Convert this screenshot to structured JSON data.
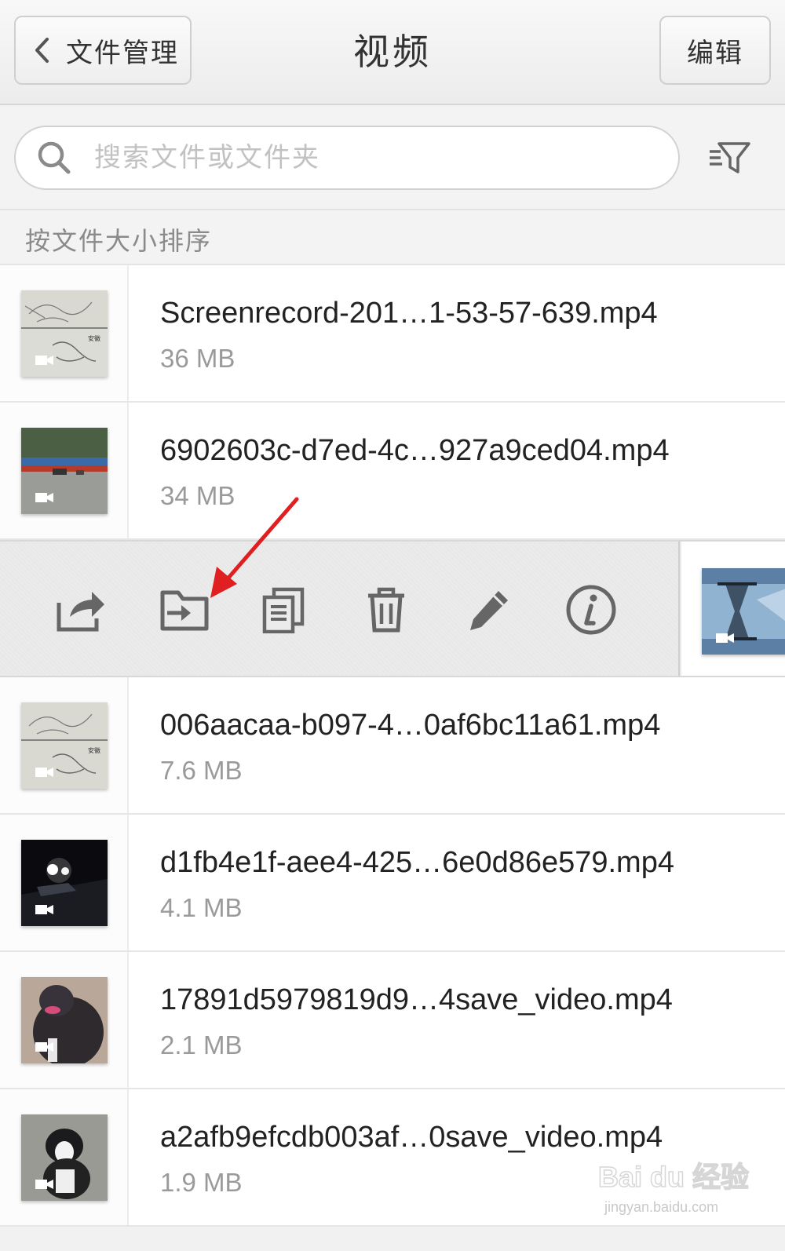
{
  "header": {
    "back_label": "文件管理",
    "title": "视频",
    "edit_label": "编辑"
  },
  "search": {
    "placeholder": "搜索文件或文件夹",
    "value": ""
  },
  "sort_label": "按文件大小排序",
  "files": [
    {
      "name": "Screenrecord-201…1-53-57-639.mp4",
      "size": "36 MB",
      "thumb": "sketch"
    },
    {
      "name": "6902603c-d7ed-4c…927a9ced04.mp4",
      "size": "34 MB",
      "thumb": "street"
    },
    {
      "name": "006aacaa-b097-4…0af6bc11a61.mp4",
      "size": "7.6 MB",
      "thumb": "sketch"
    },
    {
      "name": "d1fb4e1f-aee4-425…6e0d86e579.mp4",
      "size": "4.1 MB",
      "thumb": "night-road"
    },
    {
      "name": "17891d5979819d9…4save_video.mp4",
      "size": "2.1 MB",
      "thumb": "dog-dark"
    },
    {
      "name": "a2afb9efcdb003af…0save_video.mp4",
      "size": "1.9 MB",
      "thumb": "dog-husky"
    }
  ],
  "action_bar": {
    "actions": [
      "share-icon",
      "move-icon",
      "copy-icon",
      "delete-icon",
      "rename-icon",
      "info-icon"
    ],
    "highlighted_action": "move-icon",
    "annotation_arrow_color": "#e02020",
    "swiped_row_thumb": "hourglass"
  },
  "watermark": {
    "logo_text": "Bai du 经验",
    "sub_text": "jingyan.baidu.com"
  }
}
